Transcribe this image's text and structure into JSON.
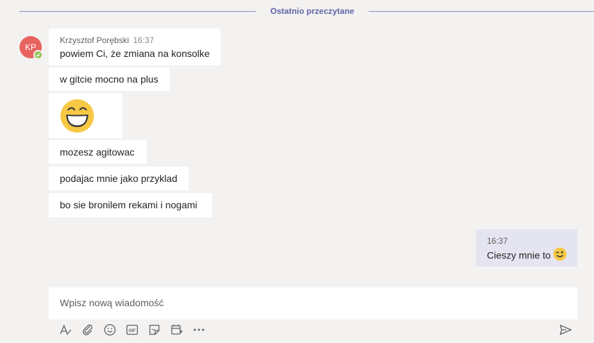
{
  "divider": {
    "label": "Ostatnio przeczytane"
  },
  "avatar": {
    "initials": "KP",
    "color": "#e8625f",
    "presence": "available"
  },
  "messages": [
    {
      "author": "Krzysztof Porębski",
      "time": "16:37",
      "text": "powiem Ci, że zmiana na konsolke"
    },
    {
      "text": "w gitcie mocno na plus"
    },
    {
      "emoji": "laughing-emoji"
    },
    {
      "text": "mozesz agitowac"
    },
    {
      "text": "podajac mnie jako przyklad"
    },
    {
      "text": "bo sie bronilem rekami i nogami"
    }
  ],
  "my_message": {
    "time": "16:37",
    "text": "Cieszy mnie to",
    "emoji": "wink-emoji"
  },
  "compose": {
    "placeholder": "Wpisz nową wiadomość",
    "value": ""
  },
  "toolbar": {
    "icons": [
      "format-icon",
      "attach-icon",
      "emoji-icon",
      "gif-icon",
      "sticker-icon",
      "schedule-meeting-icon",
      "more-options-icon"
    ],
    "send_icon": "send-icon"
  },
  "colors": {
    "accent": "#6264a7",
    "background": "#f3f2f1",
    "own_bubble": "#e5e5f1",
    "presence": "#92c353"
  }
}
